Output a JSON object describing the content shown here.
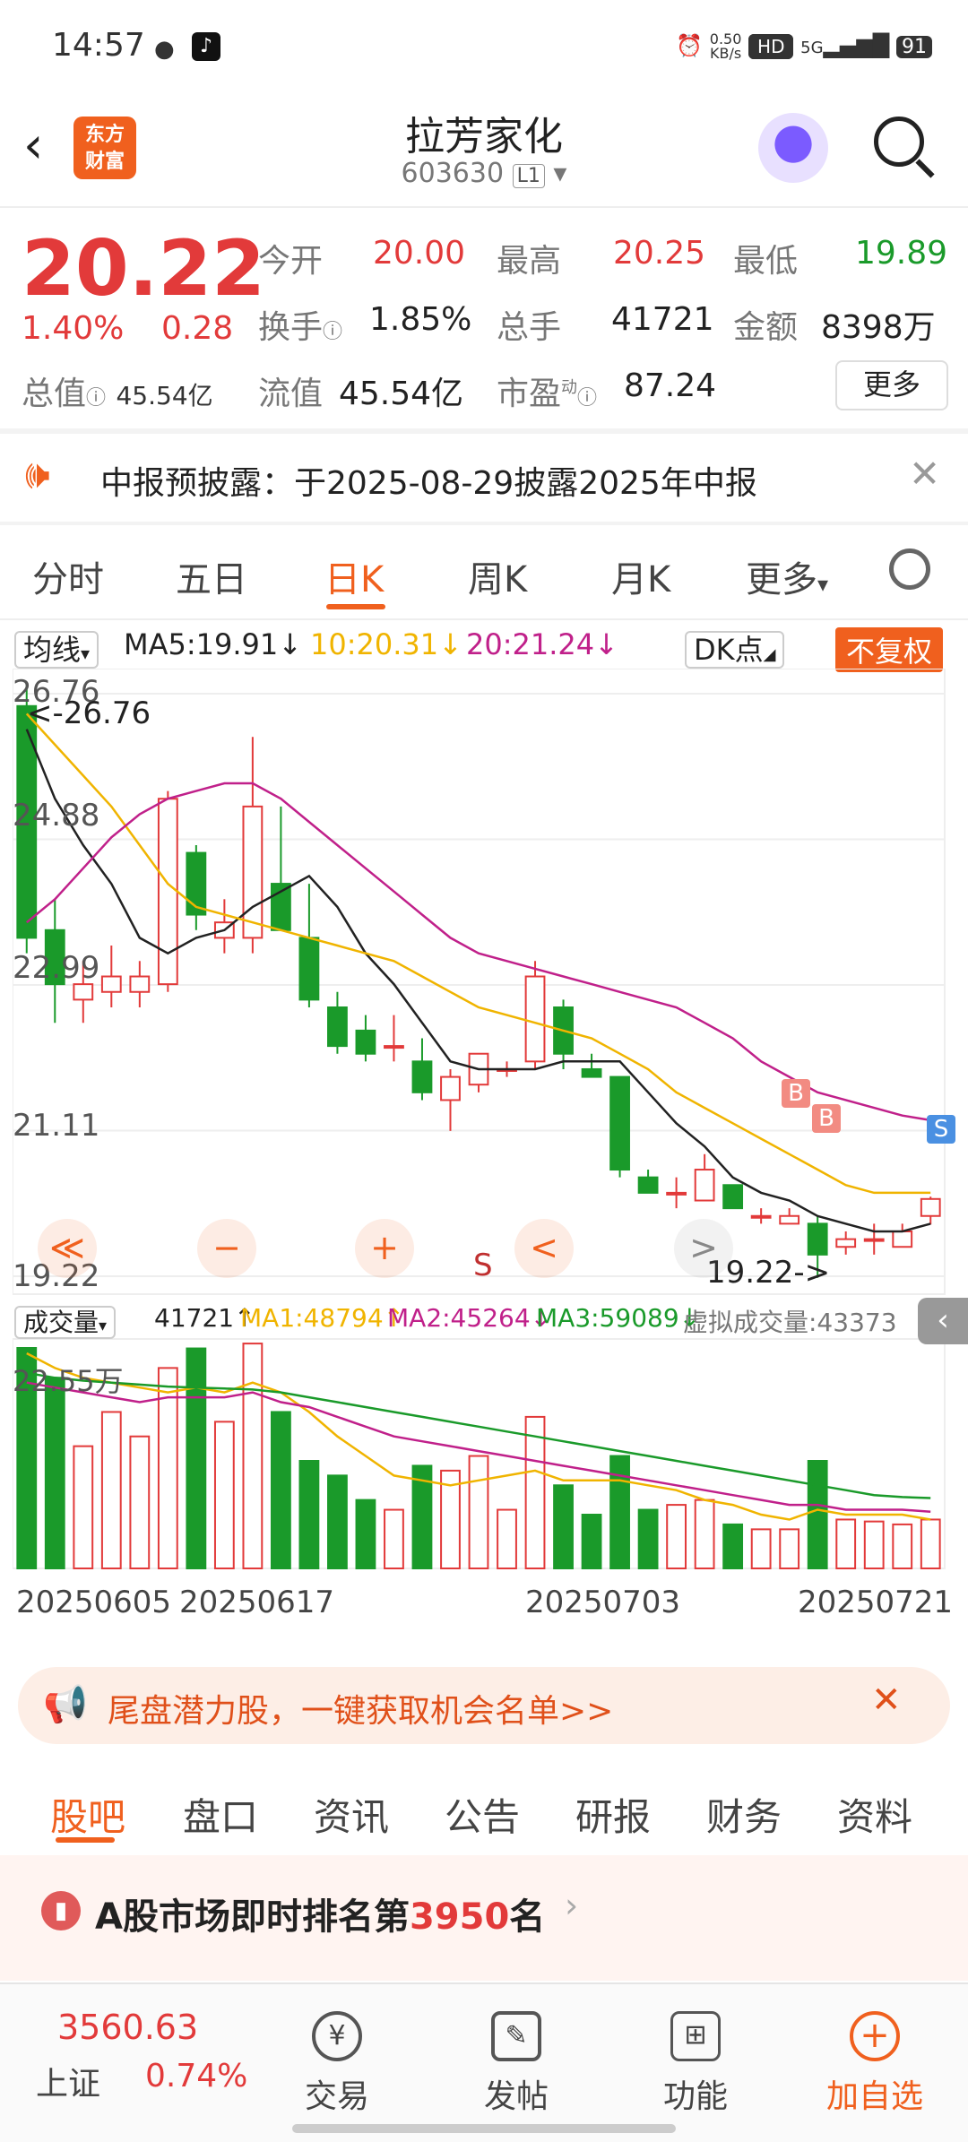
{
  "status_bar": {
    "time": "14:57",
    "net_speed_top": "0.50",
    "net_speed_bottom": "KB/s",
    "hd": "HD",
    "signal": "5G",
    "battery": "91"
  },
  "header": {
    "logo_text_1": "东方",
    "logo_text_2": "财富",
    "stock_name": "拉芳家化",
    "stock_code": "603630",
    "code_badge": "L1"
  },
  "quote": {
    "price": "20.22",
    "change_pct": "1.40%",
    "change_abs": "0.28",
    "open_label": "今开",
    "open": "20.00",
    "high_label": "最高",
    "high": "20.25",
    "low_label": "最低",
    "low": "19.89",
    "turnover_label": "换手",
    "turnover": "1.85%",
    "volume_label": "总手",
    "volume": "41721",
    "amount_label": "金额",
    "amount": "8398万",
    "mcap_label": "总值",
    "mcap": "45.54亿",
    "float_label": "流值",
    "float_cap": "45.54亿",
    "pe_label": "市盈",
    "pe_sup": "动",
    "pe": "87.24",
    "more_label": "更多"
  },
  "notice": {
    "text": "中报预披露：于2025-08-29披露2025年中报"
  },
  "tabs": {
    "items": [
      "分时",
      "五日",
      "日K",
      "周K",
      "月K",
      "更多"
    ],
    "active": "日K"
  },
  "ma_bar": {
    "selector": "均线",
    "ma5": "MA5:19.91",
    "ma10": "10:20.31",
    "ma20": "20:21.24",
    "dk": "DK点",
    "fuquan": "不复权"
  },
  "chart_labels": {
    "y_top": "26.76",
    "y_2": "24.88",
    "y_3": "22.99",
    "y_4": "21.11",
    "y_bottom": "19.22",
    "max_marker": "<-26.76",
    "min_marker": "19.22->",
    "sell_marker": "S",
    "b_marker": "B",
    "s_marker": "S"
  },
  "vol_bar": {
    "selector": "成交量",
    "vol": "41721",
    "ma1": "MA1:48794",
    "ma2": "MA2:45264",
    "ma3": "MA3:59089",
    "virtual": "虚拟成交量:43373",
    "vol_max": "22.55万"
  },
  "x_labels": [
    "20250605",
    "20250617",
    "20250703",
    "20250721"
  ],
  "colors": {
    "up": "#e23a3a",
    "down": "#1a9a2a",
    "ma5": "#222222",
    "ma10": "#f0b400",
    "ma20": "#c0208a",
    "accent": "#f0601e"
  },
  "chart_data": {
    "type": "candlestick",
    "y_range": [
      19.22,
      26.76
    ],
    "candles": [
      {
        "o": 26.6,
        "h": 26.9,
        "l": 23.4,
        "c": 23.6
      },
      {
        "o": 23.7,
        "h": 24.1,
        "l": 22.5,
        "c": 23.0
      },
      {
        "o": 22.8,
        "h": 23.3,
        "l": 22.5,
        "c": 23.0
      },
      {
        "o": 22.9,
        "h": 23.5,
        "l": 22.7,
        "c": 23.1
      },
      {
        "o": 22.9,
        "h": 23.3,
        "l": 22.7,
        "c": 23.1
      },
      {
        "o": 23.0,
        "h": 25.5,
        "l": 22.9,
        "c": 25.4
      },
      {
        "o": 24.7,
        "h": 24.8,
        "l": 23.7,
        "c": 23.9
      },
      {
        "o": 23.6,
        "h": 24.1,
        "l": 23.4,
        "c": 23.8
      },
      {
        "o": 23.6,
        "h": 26.2,
        "l": 23.4,
        "c": 25.3
      },
      {
        "o": 24.3,
        "h": 25.3,
        "l": 23.7,
        "c": 23.7
      },
      {
        "o": 23.6,
        "h": 24.3,
        "l": 22.7,
        "c": 22.8
      },
      {
        "o": 22.7,
        "h": 22.9,
        "l": 22.1,
        "c": 22.2
      },
      {
        "o": 22.4,
        "h": 22.6,
        "l": 22.0,
        "c": 22.1
      },
      {
        "o": 22.2,
        "h": 22.6,
        "l": 22.0,
        "c": 22.2
      },
      {
        "o": 22.0,
        "h": 22.3,
        "l": 21.5,
        "c": 21.6
      },
      {
        "o": 21.5,
        "h": 21.9,
        "l": 21.1,
        "c": 21.8
      },
      {
        "o": 21.7,
        "h": 22.1,
        "l": 21.6,
        "c": 22.1
      },
      {
        "o": 21.9,
        "h": 22.0,
        "l": 21.8,
        "c": 21.9
      },
      {
        "o": 22.0,
        "h": 23.3,
        "l": 21.9,
        "c": 23.1
      },
      {
        "o": 22.7,
        "h": 22.8,
        "l": 21.9,
        "c": 22.1
      },
      {
        "o": 21.9,
        "h": 22.1,
        "l": 21.8,
        "c": 21.8
      },
      {
        "o": 21.8,
        "h": 21.8,
        "l": 20.5,
        "c": 20.6
      },
      {
        "o": 20.5,
        "h": 20.6,
        "l": 20.3,
        "c": 20.3
      },
      {
        "o": 20.3,
        "h": 20.5,
        "l": 20.1,
        "c": 20.3
      },
      {
        "o": 20.2,
        "h": 20.8,
        "l": 20.2,
        "c": 20.6
      },
      {
        "o": 20.4,
        "h": 20.4,
        "l": 20.1,
        "c": 20.1
      },
      {
        "o": 20.0,
        "h": 20.1,
        "l": 19.9,
        "c": 20.0
      },
      {
        "o": 19.9,
        "h": 20.1,
        "l": 19.9,
        "c": 20.0
      },
      {
        "o": 19.9,
        "h": 20.0,
        "l": 19.2,
        "c": 19.5
      },
      {
        "o": 19.6,
        "h": 19.8,
        "l": 19.5,
        "c": 19.7
      },
      {
        "o": 19.7,
        "h": 19.9,
        "l": 19.5,
        "c": 19.7
      },
      {
        "o": 19.6,
        "h": 19.9,
        "l": 19.6,
        "c": 19.8
      },
      {
        "o": 20.0,
        "h": 20.25,
        "l": 19.89,
        "c": 20.22
      }
    ],
    "ma5": [
      26.3,
      25.4,
      24.8,
      24.3,
      23.6,
      23.4,
      23.6,
      23.7,
      24.0,
      24.2,
      24.4,
      24.0,
      23.4,
      23.0,
      22.5,
      22.0,
      21.9,
      21.9,
      21.9,
      22.0,
      22.0,
      22.0,
      21.6,
      21.2,
      20.9,
      20.5,
      20.3,
      20.2,
      20.0,
      19.9,
      19.8,
      19.8,
      19.9
    ],
    "ma10": [
      26.5,
      26.1,
      25.7,
      25.3,
      24.8,
      24.3,
      24.0,
      23.9,
      23.8,
      23.7,
      23.6,
      23.5,
      23.4,
      23.3,
      23.1,
      22.9,
      22.7,
      22.6,
      22.5,
      22.4,
      22.3,
      22.1,
      21.9,
      21.6,
      21.4,
      21.2,
      21.0,
      20.8,
      20.6,
      20.4,
      20.3,
      20.3,
      20.3
    ],
    "ma20": [
      23.8,
      24.1,
      24.5,
      24.9,
      25.2,
      25.4,
      25.5,
      25.6,
      25.6,
      25.4,
      25.1,
      24.8,
      24.5,
      24.2,
      23.9,
      23.6,
      23.4,
      23.3,
      23.2,
      23.1,
      23.0,
      22.9,
      22.8,
      22.7,
      22.5,
      22.3,
      22.0,
      21.8,
      21.6,
      21.5,
      21.4,
      21.3,
      21.24
    ],
    "volume": [
      22.55,
      19.5,
      12.5,
      16.0,
      13.5,
      20.5,
      22.5,
      15.0,
      23.0,
      16.0,
      11.0,
      9.5,
      7.0,
      6.0,
      10.5,
      10.0,
      11.5,
      6.0,
      15.5,
      8.5,
      5.5,
      11.5,
      6.0,
      6.5,
      7.0,
      4.5,
      4.0,
      4.0,
      11.0,
      5.0,
      4.8,
      4.5,
      5.0
    ],
    "vol_ma1": [
      22.0,
      20.5,
      19.5,
      19.0,
      18.5,
      18.0,
      18.5,
      18.0,
      19.0,
      18.0,
      16.0,
      13.5,
      11.5,
      9.5,
      9.0,
      8.5,
      9.0,
      9.5,
      10.0,
      9.0,
      9.0,
      9.0,
      8.5,
      8.0,
      7.0,
      6.5,
      5.5,
      5.0,
      6.0,
      5.5,
      5.5,
      5.5,
      5.0
    ],
    "vol_ma2": [
      19.0,
      18.5,
      18.0,
      17.5,
      17.0,
      17.5,
      17.5,
      17.5,
      18.0,
      17.0,
      16.5,
      15.5,
      14.5,
      13.5,
      13.0,
      12.5,
      12.0,
      11.5,
      11.0,
      10.5,
      10.0,
      9.5,
      9.0,
      8.5,
      8.0,
      7.5,
      7.0,
      6.5,
      6.5,
      6.0,
      6.0,
      6.0,
      5.8
    ],
    "vol_ma3": [
      20.0,
      19.5,
      19.2,
      19.0,
      18.8,
      18.6,
      18.5,
      18.4,
      18.3,
      18.0,
      17.5,
      17.0,
      16.5,
      16.0,
      15.5,
      15.0,
      14.5,
      14.0,
      13.5,
      13.0,
      12.5,
      12.0,
      11.5,
      11.0,
      10.5,
      10.0,
      9.5,
      9.0,
      8.5,
      8.0,
      7.5,
      7.3,
      7.2
    ],
    "vol_range": [
      0,
      22.55
    ]
  },
  "chart_controls": {
    "first": "≪",
    "zoom_out": "−",
    "zoom_in": "+",
    "prev": "<",
    "next": ">"
  },
  "ad": {
    "text": "尾盘潜力股，一键获取机会名单>>"
  },
  "bottom_tabs": {
    "items": [
      "股吧",
      "盘口",
      "资讯",
      "公告",
      "研报",
      "财务",
      "资料"
    ],
    "active": "股吧"
  },
  "rank": {
    "prefix": "A股市场即时排名第",
    "rank": "3950",
    "suffix": "名"
  },
  "bottom_bar": {
    "index_value": "3560.63",
    "index_name": "上证",
    "index_change": "0.74%",
    "trade": "交易",
    "post": "发帖",
    "func": "功能",
    "add": "加自选"
  }
}
